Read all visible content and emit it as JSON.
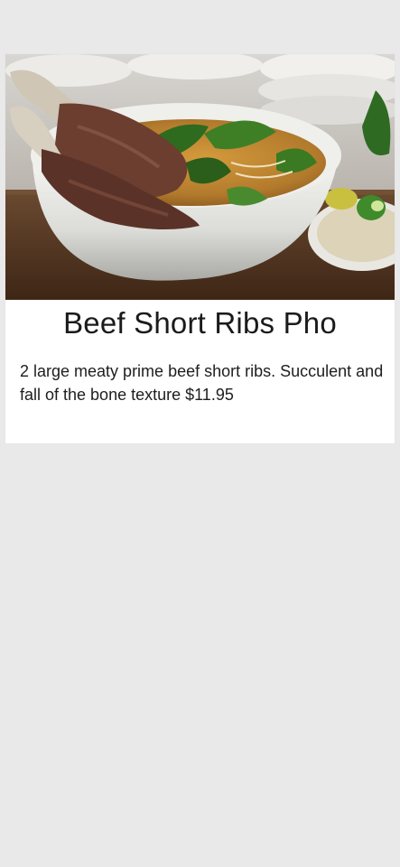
{
  "menu_item": {
    "title": "Beef Short Ribs Pho",
    "description": "2 large meaty prime beef short ribs. Succulent and fall of the bone texture $11.95",
    "image": {
      "alt": "Bowl of beef short ribs pho with herbs"
    }
  },
  "colors": {
    "page_background": "#e9e9e9",
    "card_background": "#ffffff",
    "text": "#1e1e1e"
  }
}
